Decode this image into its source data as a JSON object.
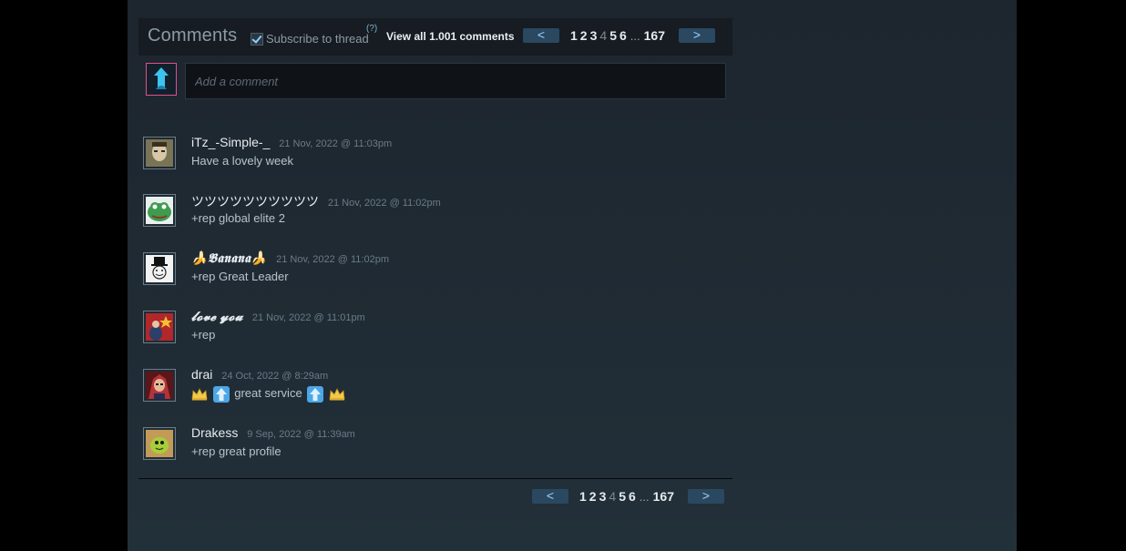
{
  "header": {
    "title": "Comments",
    "subscribe_label": "Subscribe to thread",
    "help_label": "(?)",
    "view_all": "View all 1.001 comments"
  },
  "pager": {
    "prev": "<",
    "next": ">",
    "pages": [
      "1",
      "2",
      "3",
      "4",
      "5",
      "6"
    ],
    "current_page": "4",
    "ellipsis": "...",
    "last": "167"
  },
  "composer": {
    "placeholder": "Add a comment"
  },
  "comments": [
    {
      "author": "iTz_-Simple-_",
      "time": "21 Nov, 2022 @ 11:03pm",
      "text": "Have a lovely week",
      "avatar_icon": "avatar-man-face-icon",
      "avatar_color": "#6f6a50"
    },
    {
      "author": "ツツツツツツツツツツ",
      "time": "21 Nov, 2022 @ 11:02pm",
      "text": "+rep global elite 2",
      "avatar_icon": "avatar-frog-icon",
      "avatar_color": "#3a8f4d"
    },
    {
      "author": "🍌𝕭𝖆𝖓𝖆𝖓𝖆🍌",
      "time": "21 Nov, 2022 @ 11:02pm",
      "text": "+rep Great Leader",
      "avatar_icon": "avatar-tophat-meme-icon",
      "avatar_color": "#e8e8e8"
    },
    {
      "author": "𝓵𝓸𝓿𝓮 𝔂𝓸𝓾",
      "time": "21 Nov, 2022 @ 11:01pm",
      "text": "+rep",
      "avatar_icon": "avatar-red-flag-icon",
      "avatar_color": "#b0282a"
    },
    {
      "author": "drai",
      "time": "24 Oct, 2022 @ 8:29am",
      "text": "great service",
      "avatar_icon": "avatar-anime-character-icon",
      "avatar_color": "#6a1e22"
    },
    {
      "author": "Drakess",
      "time": "9 Sep, 2022 @ 11:39am",
      "text": "+rep great profile",
      "avatar_icon": "avatar-green-slime-icon",
      "avatar_color": "#8aa83a"
    }
  ],
  "icons": {
    "crown": "crown-icon",
    "arrow": "up-arrow-icon"
  }
}
